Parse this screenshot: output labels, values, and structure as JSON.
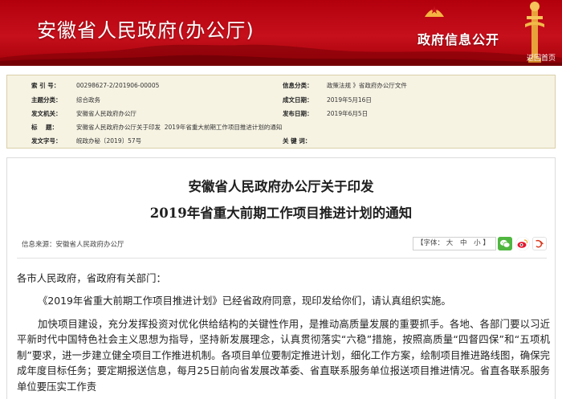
{
  "banner": {
    "site_title": "安徽省人民政府(办公厅)",
    "sub_title": "政府信息公开",
    "home_link": "返回首页",
    "colors": {
      "primary": "#b3000d",
      "accent": "#ffd34a"
    }
  },
  "meta": {
    "index_label": "索 引 号：",
    "index_value": "00298627-2/201906-00005",
    "category_label": "信息分类：",
    "category_value": "政策法规 》省政府办公厅文件",
    "topic_label": "主题分类：",
    "topic_value": "综合政务",
    "created_label": "成文日期：",
    "created_value": "2019年5月16日",
    "issuer_label": "发文机关：",
    "issuer_value": "安徽省人民政府办公厅",
    "published_label": "发布日期：",
    "published_value": "2019年6月5日",
    "subject_label": "标    题：",
    "subject_value": "安徽省人民政府办公厅关于印发  2019年省重大前期工作项目推进计划的通知",
    "docno_label": "发文字号：",
    "docno_value": "皖政办秘〔2019〕57号",
    "keywords_label": "关 键 词：",
    "keywords_value": ""
  },
  "article": {
    "title_line1": "安徽省人民政府办公厅关于印发",
    "title_line2": "2019年省重大前期工作项目推进计划的通知",
    "source": "信息来源：安徽省人民政府办公厅",
    "font_label": "【字体：",
    "font_large": "大",
    "font_medium": "中",
    "font_small": "小",
    "font_close": "】",
    "share_icons": [
      "wechat-icon",
      "weibo-icon",
      "more-share-icon"
    ],
    "salutation": "各市人民政府，省政府有关部门：",
    "paragraph1": "《2019年省重大前期工作项目推进计划》已经省政府同意，现印发给你们，请认真组织实施。",
    "paragraph2": "加快项目建设，充分发挥投资对优化供给结构的关键性作用，是推动高质量发展的重要抓手。各地、各部门要以习近平新时代中国特色社会主义思想为指导，坚持新发展理念，认真贯彻落实“六稳”措施，按照高质量“四督四保”和“五项机制”要求，进一步建立健全项目工作推进机制。各项目单位要制定推进计划，细化工作方案，绘制项目推进路线图，确保完成年度目标任务；要定期报送信息，每月25日前向省发展改革委、省直联系服务单位报送项目推进情况。省直各联系服务单位要压实工作责"
  }
}
